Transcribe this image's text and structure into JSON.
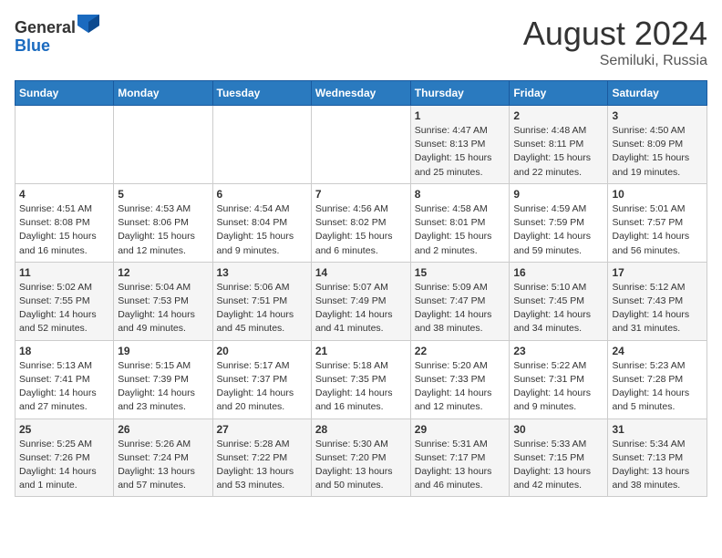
{
  "header": {
    "logo_line1": "General",
    "logo_line2": "Blue",
    "title": "August 2024",
    "location": "Semiluki, Russia"
  },
  "days_of_week": [
    "Sunday",
    "Monday",
    "Tuesday",
    "Wednesday",
    "Thursday",
    "Friday",
    "Saturday"
  ],
  "weeks": [
    [
      {
        "day": "",
        "content": ""
      },
      {
        "day": "",
        "content": ""
      },
      {
        "day": "",
        "content": ""
      },
      {
        "day": "",
        "content": ""
      },
      {
        "day": "1",
        "content": "Sunrise: 4:47 AM\nSunset: 8:13 PM\nDaylight: 15 hours\nand 25 minutes."
      },
      {
        "day": "2",
        "content": "Sunrise: 4:48 AM\nSunset: 8:11 PM\nDaylight: 15 hours\nand 22 minutes."
      },
      {
        "day": "3",
        "content": "Sunrise: 4:50 AM\nSunset: 8:09 PM\nDaylight: 15 hours\nand 19 minutes."
      }
    ],
    [
      {
        "day": "4",
        "content": "Sunrise: 4:51 AM\nSunset: 8:08 PM\nDaylight: 15 hours\nand 16 minutes."
      },
      {
        "day": "5",
        "content": "Sunrise: 4:53 AM\nSunset: 8:06 PM\nDaylight: 15 hours\nand 12 minutes."
      },
      {
        "day": "6",
        "content": "Sunrise: 4:54 AM\nSunset: 8:04 PM\nDaylight: 15 hours\nand 9 minutes."
      },
      {
        "day": "7",
        "content": "Sunrise: 4:56 AM\nSunset: 8:02 PM\nDaylight: 15 hours\nand 6 minutes."
      },
      {
        "day": "8",
        "content": "Sunrise: 4:58 AM\nSunset: 8:01 PM\nDaylight: 15 hours\nand 2 minutes."
      },
      {
        "day": "9",
        "content": "Sunrise: 4:59 AM\nSunset: 7:59 PM\nDaylight: 14 hours\nand 59 minutes."
      },
      {
        "day": "10",
        "content": "Sunrise: 5:01 AM\nSunset: 7:57 PM\nDaylight: 14 hours\nand 56 minutes."
      }
    ],
    [
      {
        "day": "11",
        "content": "Sunrise: 5:02 AM\nSunset: 7:55 PM\nDaylight: 14 hours\nand 52 minutes."
      },
      {
        "day": "12",
        "content": "Sunrise: 5:04 AM\nSunset: 7:53 PM\nDaylight: 14 hours\nand 49 minutes."
      },
      {
        "day": "13",
        "content": "Sunrise: 5:06 AM\nSunset: 7:51 PM\nDaylight: 14 hours\nand 45 minutes."
      },
      {
        "day": "14",
        "content": "Sunrise: 5:07 AM\nSunset: 7:49 PM\nDaylight: 14 hours\nand 41 minutes."
      },
      {
        "day": "15",
        "content": "Sunrise: 5:09 AM\nSunset: 7:47 PM\nDaylight: 14 hours\nand 38 minutes."
      },
      {
        "day": "16",
        "content": "Sunrise: 5:10 AM\nSunset: 7:45 PM\nDaylight: 14 hours\nand 34 minutes."
      },
      {
        "day": "17",
        "content": "Sunrise: 5:12 AM\nSunset: 7:43 PM\nDaylight: 14 hours\nand 31 minutes."
      }
    ],
    [
      {
        "day": "18",
        "content": "Sunrise: 5:13 AM\nSunset: 7:41 PM\nDaylight: 14 hours\nand 27 minutes."
      },
      {
        "day": "19",
        "content": "Sunrise: 5:15 AM\nSunset: 7:39 PM\nDaylight: 14 hours\nand 23 minutes."
      },
      {
        "day": "20",
        "content": "Sunrise: 5:17 AM\nSunset: 7:37 PM\nDaylight: 14 hours\nand 20 minutes."
      },
      {
        "day": "21",
        "content": "Sunrise: 5:18 AM\nSunset: 7:35 PM\nDaylight: 14 hours\nand 16 minutes."
      },
      {
        "day": "22",
        "content": "Sunrise: 5:20 AM\nSunset: 7:33 PM\nDaylight: 14 hours\nand 12 minutes."
      },
      {
        "day": "23",
        "content": "Sunrise: 5:22 AM\nSunset: 7:31 PM\nDaylight: 14 hours\nand 9 minutes."
      },
      {
        "day": "24",
        "content": "Sunrise: 5:23 AM\nSunset: 7:28 PM\nDaylight: 14 hours\nand 5 minutes."
      }
    ],
    [
      {
        "day": "25",
        "content": "Sunrise: 5:25 AM\nSunset: 7:26 PM\nDaylight: 14 hours\nand 1 minute."
      },
      {
        "day": "26",
        "content": "Sunrise: 5:26 AM\nSunset: 7:24 PM\nDaylight: 13 hours\nand 57 minutes."
      },
      {
        "day": "27",
        "content": "Sunrise: 5:28 AM\nSunset: 7:22 PM\nDaylight: 13 hours\nand 53 minutes."
      },
      {
        "day": "28",
        "content": "Sunrise: 5:30 AM\nSunset: 7:20 PM\nDaylight: 13 hours\nand 50 minutes."
      },
      {
        "day": "29",
        "content": "Sunrise: 5:31 AM\nSunset: 7:17 PM\nDaylight: 13 hours\nand 46 minutes."
      },
      {
        "day": "30",
        "content": "Sunrise: 5:33 AM\nSunset: 7:15 PM\nDaylight: 13 hours\nand 42 minutes."
      },
      {
        "day": "31",
        "content": "Sunrise: 5:34 AM\nSunset: 7:13 PM\nDaylight: 13 hours\nand 38 minutes."
      }
    ]
  ]
}
